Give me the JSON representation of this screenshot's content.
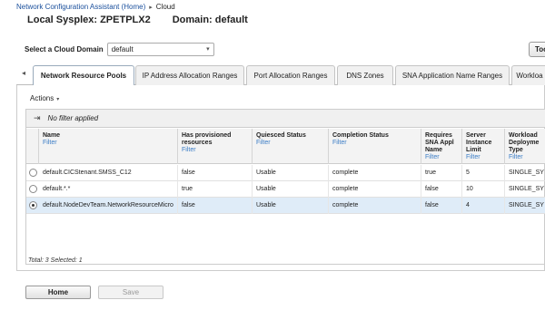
{
  "breadcrumb": {
    "home": "Network Configuration Assistant (Home)",
    "current": "Cloud"
  },
  "heading": {
    "sysplex": "Local Sysplex: ZPETPLX2",
    "domain": "Domain: default"
  },
  "domain_select": {
    "label": "Select a Cloud Domain",
    "value": "default"
  },
  "top_button": "Too",
  "tabs": [
    {
      "label": "Network Resource Pools",
      "active": true
    },
    {
      "label": "IP Address Allocation Ranges"
    },
    {
      "label": "Port Allocation Ranges"
    },
    {
      "label": "DNS Zones"
    },
    {
      "label": "SNA Application Name Ranges"
    },
    {
      "label": "Workloa"
    }
  ],
  "actions": {
    "label": "Actions"
  },
  "filter": {
    "text": "No filter applied"
  },
  "table": {
    "filter_link": "Filter",
    "columns": [
      {
        "label": "Name"
      },
      {
        "label": "Has provisioned resources"
      },
      {
        "label": "Quiesced Status"
      },
      {
        "label": "Completion Status"
      },
      {
        "label": "Requires SNA Appl Name"
      },
      {
        "label": "Server Instance Limit"
      },
      {
        "label": "Workload Deployme Type"
      }
    ],
    "rows": [
      {
        "cells": [
          "default.CICStenant.SMSS_C12",
          "false",
          "Usable",
          "complete",
          "true",
          "5",
          "SINGLE_SY"
        ],
        "selected": false
      },
      {
        "cells": [
          "default.*.*",
          "true",
          "Usable",
          "complete",
          "false",
          "10",
          "SINGLE_SY"
        ],
        "selected": false
      },
      {
        "cells": [
          "default.NodeDevTeam.NetworkResourceMicro",
          "false",
          "Usable",
          "complete",
          "false",
          "4",
          "SINGLE_SY"
        ],
        "selected": true
      }
    ]
  },
  "footer": {
    "total": "Total: 3 Selected: 1"
  },
  "buttons": {
    "home": "Home",
    "save": "Save"
  },
  "colors": {
    "link": "#1a4f9c",
    "filter": "#3a7cc6",
    "selected_row": "#dfecf8"
  }
}
